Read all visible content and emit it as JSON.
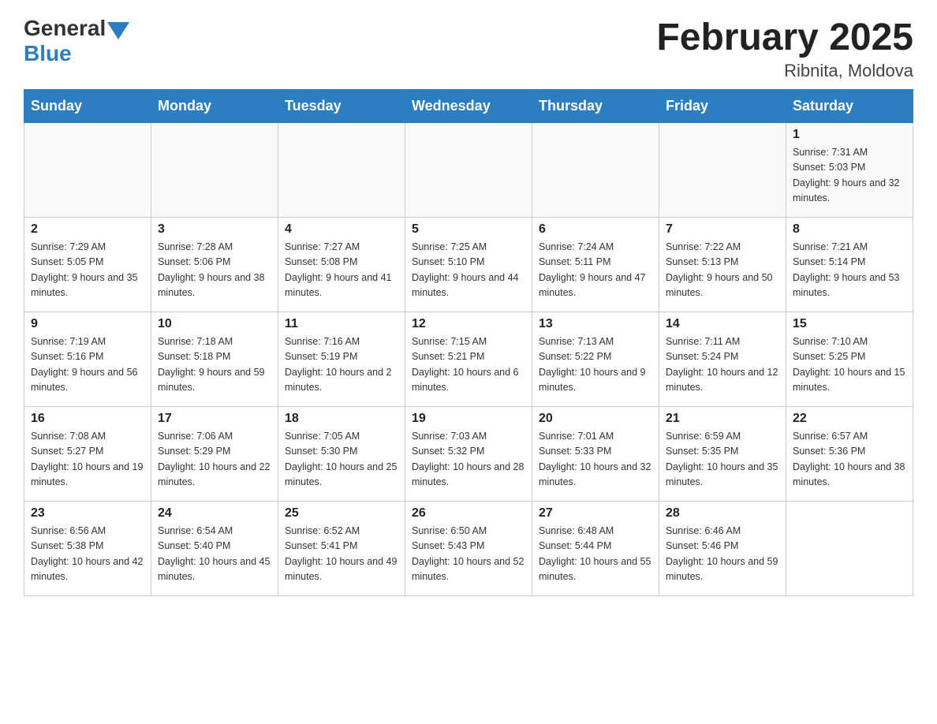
{
  "header": {
    "logo_general": "General",
    "logo_blue": "Blue",
    "month_title": "February 2025",
    "location": "Ribnita, Moldova"
  },
  "days_of_week": [
    "Sunday",
    "Monday",
    "Tuesday",
    "Wednesday",
    "Thursday",
    "Friday",
    "Saturday"
  ],
  "weeks": [
    [
      {
        "day": "",
        "sunrise": "",
        "sunset": "",
        "daylight": ""
      },
      {
        "day": "",
        "sunrise": "",
        "sunset": "",
        "daylight": ""
      },
      {
        "day": "",
        "sunrise": "",
        "sunset": "",
        "daylight": ""
      },
      {
        "day": "",
        "sunrise": "",
        "sunset": "",
        "daylight": ""
      },
      {
        "day": "",
        "sunrise": "",
        "sunset": "",
        "daylight": ""
      },
      {
        "day": "",
        "sunrise": "",
        "sunset": "",
        "daylight": ""
      },
      {
        "day": "1",
        "sunrise": "Sunrise: 7:31 AM",
        "sunset": "Sunset: 5:03 PM",
        "daylight": "Daylight: 9 hours and 32 minutes."
      }
    ],
    [
      {
        "day": "2",
        "sunrise": "Sunrise: 7:29 AM",
        "sunset": "Sunset: 5:05 PM",
        "daylight": "Daylight: 9 hours and 35 minutes."
      },
      {
        "day": "3",
        "sunrise": "Sunrise: 7:28 AM",
        "sunset": "Sunset: 5:06 PM",
        "daylight": "Daylight: 9 hours and 38 minutes."
      },
      {
        "day": "4",
        "sunrise": "Sunrise: 7:27 AM",
        "sunset": "Sunset: 5:08 PM",
        "daylight": "Daylight: 9 hours and 41 minutes."
      },
      {
        "day": "5",
        "sunrise": "Sunrise: 7:25 AM",
        "sunset": "Sunset: 5:10 PM",
        "daylight": "Daylight: 9 hours and 44 minutes."
      },
      {
        "day": "6",
        "sunrise": "Sunrise: 7:24 AM",
        "sunset": "Sunset: 5:11 PM",
        "daylight": "Daylight: 9 hours and 47 minutes."
      },
      {
        "day": "7",
        "sunrise": "Sunrise: 7:22 AM",
        "sunset": "Sunset: 5:13 PM",
        "daylight": "Daylight: 9 hours and 50 minutes."
      },
      {
        "day": "8",
        "sunrise": "Sunrise: 7:21 AM",
        "sunset": "Sunset: 5:14 PM",
        "daylight": "Daylight: 9 hours and 53 minutes."
      }
    ],
    [
      {
        "day": "9",
        "sunrise": "Sunrise: 7:19 AM",
        "sunset": "Sunset: 5:16 PM",
        "daylight": "Daylight: 9 hours and 56 minutes."
      },
      {
        "day": "10",
        "sunrise": "Sunrise: 7:18 AM",
        "sunset": "Sunset: 5:18 PM",
        "daylight": "Daylight: 9 hours and 59 minutes."
      },
      {
        "day": "11",
        "sunrise": "Sunrise: 7:16 AM",
        "sunset": "Sunset: 5:19 PM",
        "daylight": "Daylight: 10 hours and 2 minutes."
      },
      {
        "day": "12",
        "sunrise": "Sunrise: 7:15 AM",
        "sunset": "Sunset: 5:21 PM",
        "daylight": "Daylight: 10 hours and 6 minutes."
      },
      {
        "day": "13",
        "sunrise": "Sunrise: 7:13 AM",
        "sunset": "Sunset: 5:22 PM",
        "daylight": "Daylight: 10 hours and 9 minutes."
      },
      {
        "day": "14",
        "sunrise": "Sunrise: 7:11 AM",
        "sunset": "Sunset: 5:24 PM",
        "daylight": "Daylight: 10 hours and 12 minutes."
      },
      {
        "day": "15",
        "sunrise": "Sunrise: 7:10 AM",
        "sunset": "Sunset: 5:25 PM",
        "daylight": "Daylight: 10 hours and 15 minutes."
      }
    ],
    [
      {
        "day": "16",
        "sunrise": "Sunrise: 7:08 AM",
        "sunset": "Sunset: 5:27 PM",
        "daylight": "Daylight: 10 hours and 19 minutes."
      },
      {
        "day": "17",
        "sunrise": "Sunrise: 7:06 AM",
        "sunset": "Sunset: 5:29 PM",
        "daylight": "Daylight: 10 hours and 22 minutes."
      },
      {
        "day": "18",
        "sunrise": "Sunrise: 7:05 AM",
        "sunset": "Sunset: 5:30 PM",
        "daylight": "Daylight: 10 hours and 25 minutes."
      },
      {
        "day": "19",
        "sunrise": "Sunrise: 7:03 AM",
        "sunset": "Sunset: 5:32 PM",
        "daylight": "Daylight: 10 hours and 28 minutes."
      },
      {
        "day": "20",
        "sunrise": "Sunrise: 7:01 AM",
        "sunset": "Sunset: 5:33 PM",
        "daylight": "Daylight: 10 hours and 32 minutes."
      },
      {
        "day": "21",
        "sunrise": "Sunrise: 6:59 AM",
        "sunset": "Sunset: 5:35 PM",
        "daylight": "Daylight: 10 hours and 35 minutes."
      },
      {
        "day": "22",
        "sunrise": "Sunrise: 6:57 AM",
        "sunset": "Sunset: 5:36 PM",
        "daylight": "Daylight: 10 hours and 38 minutes."
      }
    ],
    [
      {
        "day": "23",
        "sunrise": "Sunrise: 6:56 AM",
        "sunset": "Sunset: 5:38 PM",
        "daylight": "Daylight: 10 hours and 42 minutes."
      },
      {
        "day": "24",
        "sunrise": "Sunrise: 6:54 AM",
        "sunset": "Sunset: 5:40 PM",
        "daylight": "Daylight: 10 hours and 45 minutes."
      },
      {
        "day": "25",
        "sunrise": "Sunrise: 6:52 AM",
        "sunset": "Sunset: 5:41 PM",
        "daylight": "Daylight: 10 hours and 49 minutes."
      },
      {
        "day": "26",
        "sunrise": "Sunrise: 6:50 AM",
        "sunset": "Sunset: 5:43 PM",
        "daylight": "Daylight: 10 hours and 52 minutes."
      },
      {
        "day": "27",
        "sunrise": "Sunrise: 6:48 AM",
        "sunset": "Sunset: 5:44 PM",
        "daylight": "Daylight: 10 hours and 55 minutes."
      },
      {
        "day": "28",
        "sunrise": "Sunrise: 6:46 AM",
        "sunset": "Sunset: 5:46 PM",
        "daylight": "Daylight: 10 hours and 59 minutes."
      },
      {
        "day": "",
        "sunrise": "",
        "sunset": "",
        "daylight": ""
      }
    ]
  ]
}
